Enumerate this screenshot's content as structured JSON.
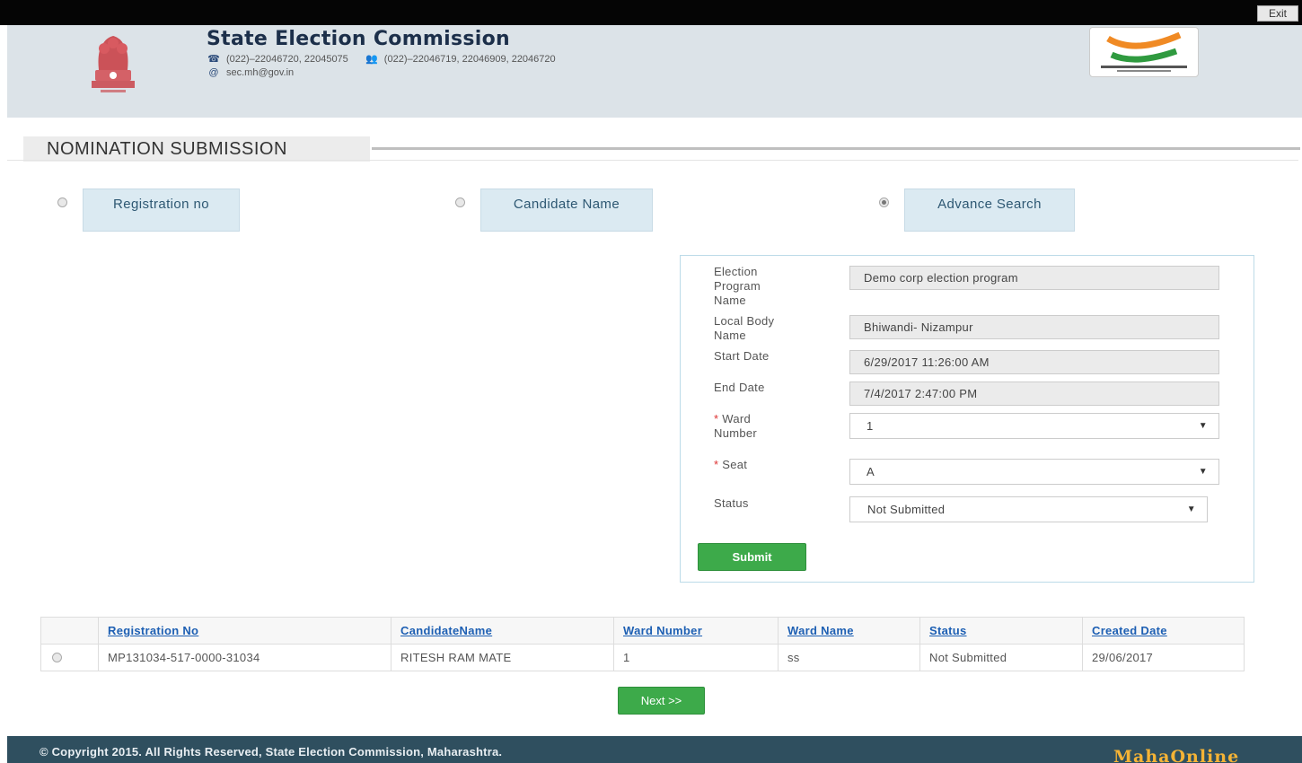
{
  "topbar": {
    "exit_label": "Exit"
  },
  "header": {
    "title": "State Election Commission",
    "phone": "(022)–22046720, 22045075",
    "fax": "(022)–22046719, 22046909, 22046720",
    "email": "sec.mh@gov.in"
  },
  "page": {
    "section_title": "NOMINATION SUBMISSION"
  },
  "search_options": [
    {
      "label": "Registration no",
      "selected": false
    },
    {
      "label": "Candidate Name",
      "selected": false
    },
    {
      "label": "Advance Search",
      "selected": true
    }
  ],
  "form": {
    "election_program": {
      "label": "Election Program Name",
      "value": "Demo corp election program"
    },
    "local_body": {
      "label": "Local Body Name",
      "value": "Bhiwandi- Nizampur"
    },
    "start_date": {
      "label": "Start Date",
      "value": "6/29/2017 11:26:00 AM"
    },
    "end_date": {
      "label": "End Date",
      "value": "7/4/2017 2:47:00 PM"
    },
    "ward_number": {
      "label": "Ward Number",
      "value": "1"
    },
    "seat": {
      "label": "Seat",
      "value": "A"
    },
    "status": {
      "label": "Status",
      "value": "Not Submitted"
    },
    "required_mark": "*",
    "submit_label": "Submit"
  },
  "table": {
    "headers": [
      "Registration No",
      "CandidateName",
      "Ward Number",
      "Ward Name",
      "Status",
      "Created Date"
    ],
    "rows": [
      [
        "MP131034-517-0000-31034",
        "RITESH RAM MATE",
        "1",
        "ss",
        "Not Submitted",
        "29/06/2017"
      ]
    ]
  },
  "pager": {
    "next_label": "Next >>"
  },
  "footer": {
    "copyright": "© Copyright 2015. All Rights Reserved, State Election Commission, Maharashtra.",
    "brand": "MahaOnline"
  },
  "colors": {
    "accent_green": "#3daa4a",
    "header_bg": "#dce3e8",
    "footer_bg": "#2f4f5f",
    "link_blue": "#1d5fb3"
  }
}
